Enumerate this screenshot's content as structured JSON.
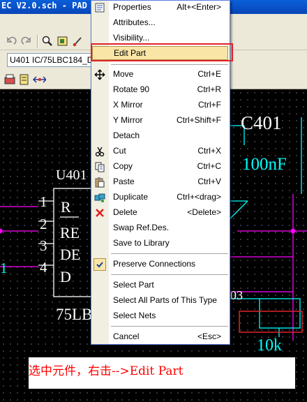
{
  "window": {
    "title": "EC V2.0.sch - PAD"
  },
  "part_selector": {
    "value": "U401 IC/75LBC184_D"
  },
  "schematic": {
    "u401": {
      "ref": "U401",
      "value": "75LB",
      "pins": [
        "1",
        "2",
        "3",
        "4"
      ],
      "pin_names": [
        "R",
        "RE",
        "DE",
        "D"
      ]
    },
    "c401": {
      "ref": "C401",
      "value": "100nF"
    },
    "resistor": {
      "ref_fragment": "03",
      "value": "10k"
    },
    "net_label": "1"
  },
  "context_menu": {
    "items": [
      {
        "label": "Properties",
        "shortcut": "Alt+<Enter>",
        "icon": "properties-icon"
      },
      {
        "label": "Attributes...",
        "shortcut": ""
      },
      {
        "label": "Visibility...",
        "shortcut": ""
      },
      {
        "label": "Edit Part",
        "shortcut": "",
        "highlighted": true
      },
      {
        "label": "Move",
        "shortcut": "Ctrl+E",
        "icon": "move-icon"
      },
      {
        "label": "Rotate 90",
        "shortcut": "Ctrl+R"
      },
      {
        "label": "X Mirror",
        "shortcut": "Ctrl+F"
      },
      {
        "label": "Y Mirror",
        "shortcut": "Ctrl+Shift+F"
      },
      {
        "label": "Detach",
        "shortcut": ""
      },
      {
        "label": "Cut",
        "shortcut": "Ctrl+X",
        "icon": "cut-icon"
      },
      {
        "label": "Copy",
        "shortcut": "Ctrl+C",
        "icon": "copy-icon"
      },
      {
        "label": "Paste",
        "shortcut": "Ctrl+V",
        "icon": "paste-icon"
      },
      {
        "label": "Duplicate",
        "shortcut": "Ctrl+<drag>",
        "icon": "duplicate-icon"
      },
      {
        "label": "Delete",
        "shortcut": "<Delete>",
        "icon": "delete-icon"
      },
      {
        "label": "Swap Ref.Des.",
        "shortcut": ""
      },
      {
        "label": "Save to Library",
        "shortcut": ""
      },
      {
        "label": "Preserve Connections",
        "shortcut": "",
        "checked": true
      },
      {
        "label": "Select Part",
        "shortcut": ""
      },
      {
        "label": "Select All Parts of This Type",
        "shortcut": ""
      },
      {
        "label": "Select Nets",
        "shortcut": ""
      },
      {
        "label": "Cancel",
        "shortcut": "<Esc>"
      }
    ]
  },
  "caption": {
    "text": "选中元件，右击-->Edit Part"
  },
  "colors": {
    "wire": "#ff00ff",
    "component": "#00ffff",
    "text": "#ffffff",
    "highlight": "#f9e6a6",
    "annotation": "#ff0000"
  }
}
